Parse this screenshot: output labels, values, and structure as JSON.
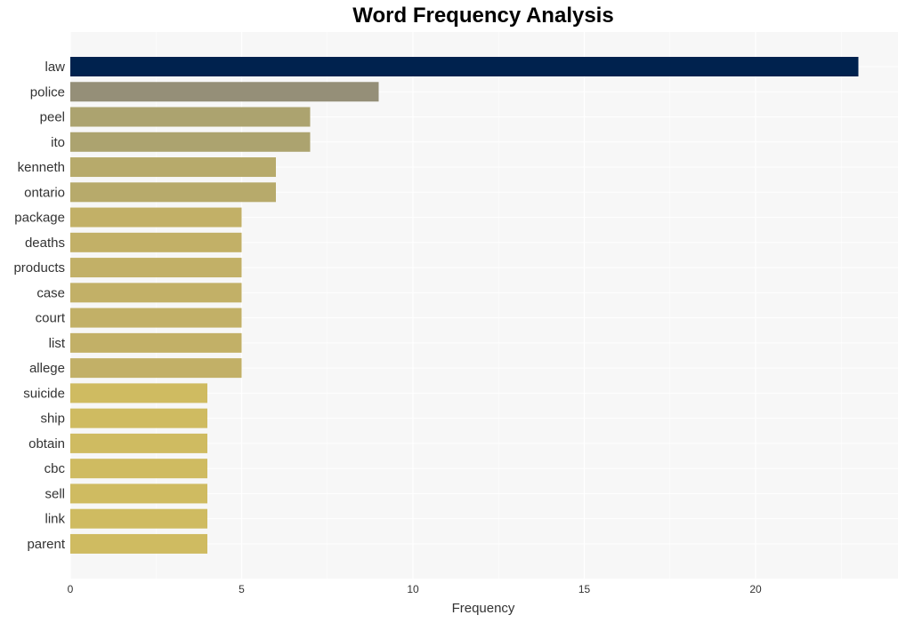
{
  "chart_data": {
    "type": "bar",
    "orientation": "horizontal",
    "title": "Word Frequency Analysis",
    "xlabel": "Frequency",
    "ylabel": "",
    "xlim": [
      0,
      24.1
    ],
    "xticks": [
      0,
      5,
      10,
      15,
      20
    ],
    "grid": true,
    "categories": [
      "law",
      "police",
      "peel",
      "ito",
      "kenneth",
      "ontario",
      "package",
      "deaths",
      "products",
      "case",
      "court",
      "list",
      "allege",
      "suicide",
      "ship",
      "obtain",
      "cbc",
      "sell",
      "link",
      "parent"
    ],
    "values": [
      23,
      9,
      7,
      7,
      6,
      6,
      5,
      5,
      5,
      5,
      5,
      5,
      5,
      4,
      4,
      4,
      4,
      4,
      4,
      4
    ],
    "colors": [
      "#00224e",
      "#958f78",
      "#aca36f",
      "#aca36f",
      "#b7aa6b",
      "#b7aa6b",
      "#c2b067",
      "#c2b067",
      "#c2b067",
      "#c2b067",
      "#c2b067",
      "#c2b067",
      "#c2b067",
      "#cfbb61",
      "#cfbb61",
      "#cfbb61",
      "#cfbb61",
      "#cfbb61",
      "#cfbb61",
      "#cfbb61"
    ],
    "background": "#f7f7f7"
  }
}
